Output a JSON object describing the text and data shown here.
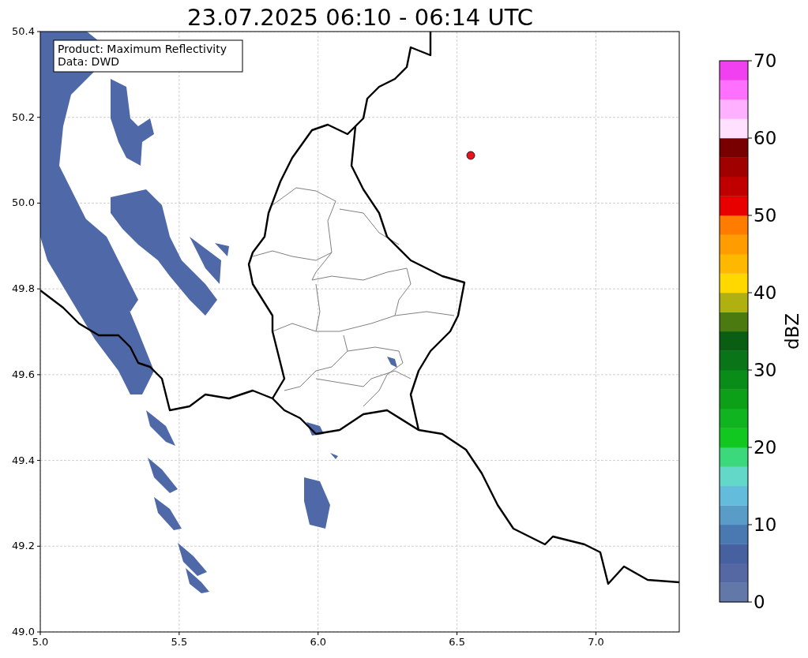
{
  "title": "23.07.2025 06:10 - 06:14 UTC",
  "annotation": {
    "lines": [
      "Product: Maximum Reflectivity",
      "Data: DWD"
    ]
  },
  "x_axis": {
    "ticks": [
      "5.0",
      "5.5",
      "6.0",
      "6.5",
      "7.0"
    ]
  },
  "y_axis": {
    "ticks": [
      "50.4",
      "50.2",
      "50.0",
      "49.8",
      "49.6",
      "49.4",
      "49.2",
      "49.0"
    ]
  },
  "colorbar": {
    "label": "dBZ",
    "ticks": [
      "70",
      "60",
      "50",
      "40",
      "30",
      "20",
      "10",
      "0"
    ],
    "bins": [
      {
        "color": "#6278a8"
      },
      {
        "color": "#5668a4"
      },
      {
        "color": "#4660a0"
      },
      {
        "color": "#4a78b0"
      },
      {
        "color": "#5a9cc8"
      },
      {
        "color": "#64bcdc"
      },
      {
        "color": "#64d8c8"
      },
      {
        "color": "#3cd87c"
      },
      {
        "color": "#10c820"
      },
      {
        "color": "#10b420"
      },
      {
        "color": "#0ca018"
      },
      {
        "color": "#0a8c18"
      },
      {
        "color": "#0a7418"
      },
      {
        "color": "#0a5e14"
      },
      {
        "color": "#4a7a10"
      },
      {
        "color": "#b0b010"
      },
      {
        "color": "#ffd800"
      },
      {
        "color": "#ffb800"
      },
      {
        "color": "#ff9c00"
      },
      {
        "color": "#ff7c00"
      },
      {
        "color": "#e80000"
      },
      {
        "color": "#c00000"
      },
      {
        "color": "#a00000"
      },
      {
        "color": "#780000"
      },
      {
        "color": "#ffe0ff"
      },
      {
        "color": "#ffb0ff"
      },
      {
        "color": "#ff70ff"
      },
      {
        "color": "#f040f0"
      }
    ]
  }
}
